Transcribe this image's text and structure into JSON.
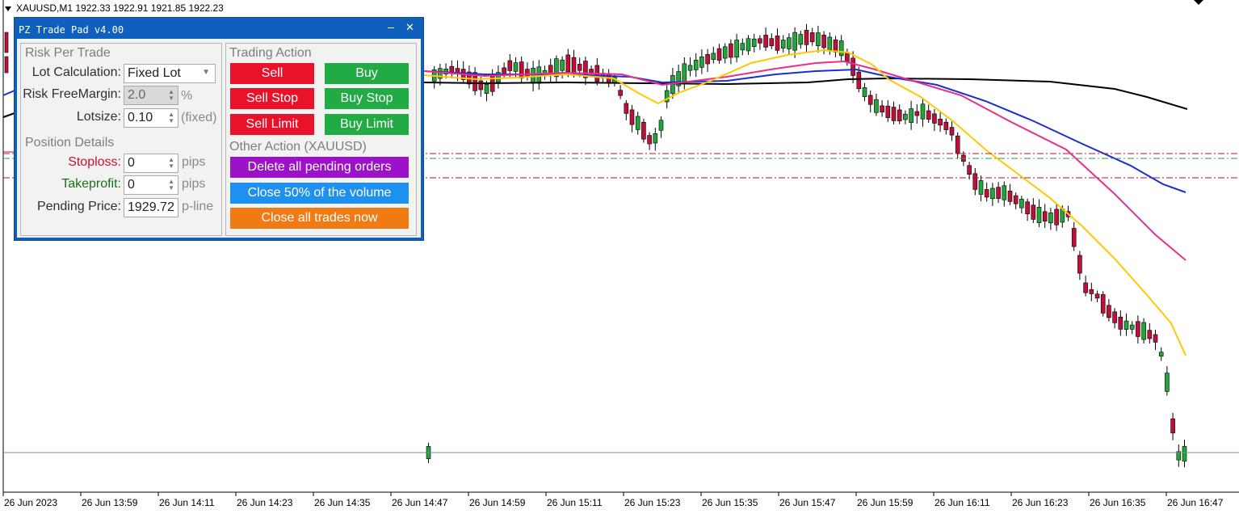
{
  "chart": {
    "symbol_header": "XAUUSD,M1  1922.33 1922.91 1921.85 1922.23",
    "time_labels": [
      "26 Jun 2023",
      "26 Jun 13:59",
      "26 Jun 14:11",
      "26 Jun 14:23",
      "26 Jun 14:35",
      "26 Jun 14:47",
      "26 Jun 14:59",
      "26 Jun 15:11",
      "26 Jun 15:23",
      "26 Jun 15:35",
      "26 Jun 15:47",
      "26 Jun 15:59",
      "26 Jun 16:11",
      "26 Jun 16:23",
      "26 Jun 16:35",
      "26 Jun 16:47"
    ],
    "colors": {
      "bull": "#22a63a",
      "bear": "#c0103a",
      "ma_yellow": "#ffc800",
      "ma_magenta": "#e8308a",
      "ma_blue": "#1a2fcf",
      "ma_black": "#000000",
      "red_dashed": "#c0103a",
      "green_dashed": "#22a63a",
      "bid_line": "#7a8a99"
    }
  },
  "panel": {
    "title": "PZ Trade Pad v4.00",
    "minimize_glyph": "–",
    "close_glyph": "✕",
    "risk": {
      "heading": "Risk Per Trade",
      "lot_calc_label": "Lot Calculation:",
      "lot_calc_value": "Fixed Lot",
      "risk_free_margin_label": "Risk FreeMargin:",
      "risk_free_margin_value": "2.0",
      "risk_unit": "%",
      "lotsize_label": "Lotsize:",
      "lotsize_value": "0.10",
      "lotsize_unit": "(fixed)"
    },
    "position": {
      "heading": "Position Details",
      "stoploss_label": "Stoploss:",
      "stoploss_value": "0",
      "stoploss_unit": "pips",
      "takeprofit_label": "Takeprofit:",
      "takeprofit_value": "0",
      "takeprofit_unit": "pips",
      "pending_label": "Pending Price:",
      "pending_value": "1929.72",
      "pending_unit": "p-line"
    },
    "trading": {
      "heading": "Trading Action",
      "sell": "Sell",
      "buy": "Buy",
      "sell_stop": "Sell Stop",
      "buy_stop": "Buy Stop",
      "sell_limit": "Sell Limit",
      "buy_limit": "Buy Limit"
    },
    "other": {
      "heading": "Other Action (XAUUSD)",
      "delete_pending": "Delete all pending orders",
      "close_half": "Close 50% of the volume",
      "close_all": "Close all trades now"
    },
    "colors": {
      "title_bar": "#0f5fbd",
      "sell": "#e8132b",
      "buy": "#22aa44",
      "delete": "#9c12c9",
      "close_half": "#1e90ef",
      "close_all": "#f07a14",
      "stoploss_label": "#c8102e",
      "takeprofit_label": "#1b6e1b"
    }
  }
}
